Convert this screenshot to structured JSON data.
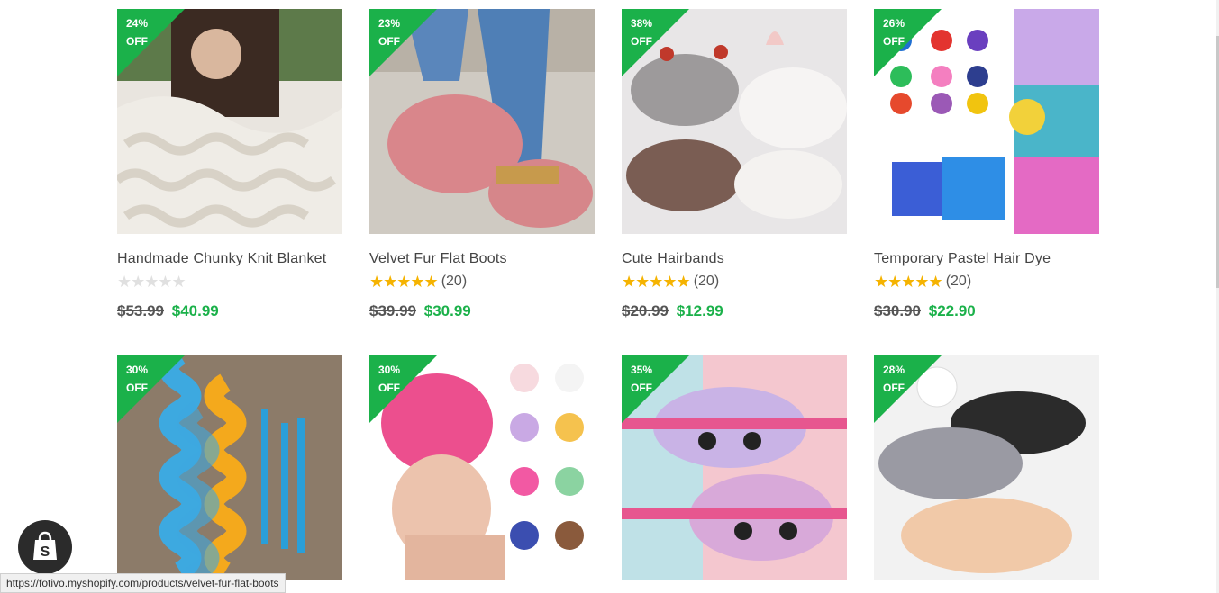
{
  "products": [
    {
      "title": "Handmade Chunky Knit Blanket",
      "discount": "24%\nOFF",
      "old_price": "$53.99",
      "new_price": "$40.99",
      "stars": "★★★★★",
      "rated": false,
      "count": "",
      "image": "knit-blanket",
      "bg": "#e9e5df"
    },
    {
      "title": "Velvet Fur Flat Boots",
      "discount": "23%\nOFF",
      "old_price": "$39.99",
      "new_price": "$30.99",
      "stars": "★★★★★",
      "rated": true,
      "count": "(20)",
      "image": "pink-boots",
      "bg": "#cfcac2"
    },
    {
      "title": "Cute Hairbands",
      "discount": "38%\nOFF",
      "old_price": "$20.99",
      "new_price": "$12.99",
      "stars": "★★★★★",
      "rated": true,
      "count": "(20)",
      "image": "hairbands",
      "bg": "#e8e6e7"
    },
    {
      "title": "Temporary Pastel Hair Dye",
      "discount": "26%\nOFF",
      "old_price": "$30.90",
      "new_price": "$22.90",
      "stars": "★★★★★",
      "rated": true,
      "count": "(20)",
      "image": "hair-dye",
      "bg": "#ffffff"
    },
    {
      "title": "",
      "discount": "30%\nOFF",
      "image": "hair-curlers",
      "bg": "#8c7b69"
    },
    {
      "title": "",
      "discount": "30%\nOFF",
      "image": "hair-towel",
      "bg": "#ffffff"
    },
    {
      "title": "",
      "discount": "35%\nOFF",
      "image": "unicorn-bags",
      "bg": "#f4c7cf"
    },
    {
      "title": "",
      "discount": "28%\nOFF",
      "image": "strapless-bras",
      "bg": "#f2f2f2"
    }
  ],
  "status_url": "https://fotivo.myshopify.com/products/velvet-fur-flat-boots",
  "colors": {
    "accent": "#1bb14a",
    "star": "#f5b301"
  }
}
